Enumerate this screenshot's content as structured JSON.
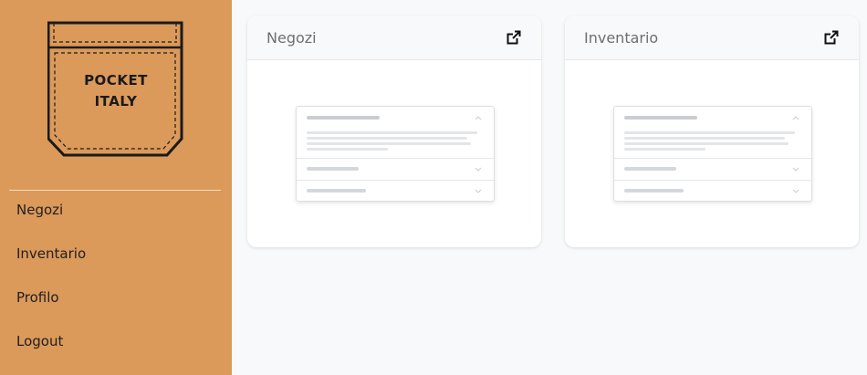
{
  "logo": {
    "line1": "POCKET",
    "line2": "ITALY"
  },
  "nav": {
    "items": [
      {
        "label": "Negozi"
      },
      {
        "label": "Inventario"
      },
      {
        "label": "Profilo"
      },
      {
        "label": "Logout"
      }
    ]
  },
  "cards": [
    {
      "title": "Negozi",
      "icon": "external-link-icon"
    },
    {
      "title": "Inventario",
      "icon": "external-link-icon"
    }
  ],
  "colors": {
    "sidebar": "#db995a",
    "background": "#f8f9fa",
    "card": "#ffffff"
  }
}
